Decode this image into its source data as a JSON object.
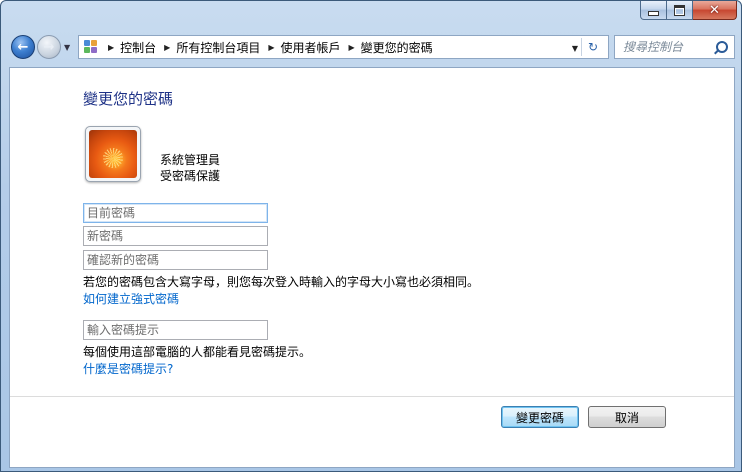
{
  "window": {
    "controls": {
      "minimize_icon": "minimize-icon",
      "maximize_icon": "maximize-icon",
      "close_glyph": "✕"
    }
  },
  "nav": {
    "back_glyph": "←",
    "forward_glyph": "→",
    "breadcrumbs": [
      "控制台",
      "所有控制台項目",
      "使用者帳戶",
      "變更您的密碼"
    ],
    "search_placeholder": "搜尋控制台"
  },
  "page": {
    "heading": "變更您的密碼",
    "user": {
      "name": "系統管理員",
      "status": "受密碼保護"
    },
    "fields": {
      "current_password_placeholder": "目前密碼",
      "new_password_placeholder": "新密碼",
      "confirm_password_placeholder": "確認新的密碼",
      "hint_placeholder": "輸入密碼提示"
    },
    "case_note": "若您的密碼包含大寫字母，則您每次登入時輸入的字母大小寫也必須相同。",
    "strong_password_link": "如何建立強式密碼",
    "hint_note": "每個使用這部電腦的人都能看見密碼提示。",
    "hint_link": "什麼是密碼提示?",
    "buttons": {
      "change": "變更密碼",
      "cancel": "取消"
    }
  },
  "colors": {
    "heading": "#1e3287",
    "link": "#0066cc",
    "window_frame": "#b9d1ea"
  }
}
